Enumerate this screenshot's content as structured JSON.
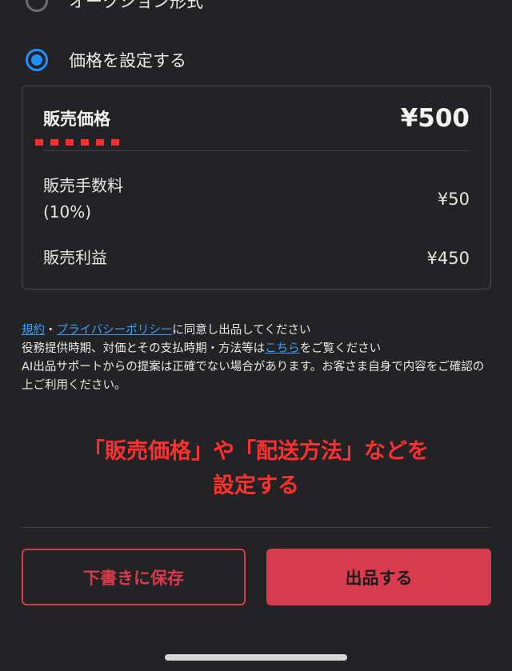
{
  "options": {
    "auction_label": "オークション形式",
    "fixed_price_label": "価格を設定する",
    "selected": "fixed_price"
  },
  "price_card": {
    "sale_price_label": "販売価格",
    "sale_price_value": "¥500",
    "fee_label_line1": "販売手数料",
    "fee_label_line2": "(10%)",
    "fee_value": "¥50",
    "profit_label": "販売利益",
    "profit_value": "¥450"
  },
  "notice": {
    "terms_link": "規約",
    "separator": "・",
    "privacy_link": "プライバシーポリシー",
    "agree_text": "に同意し出品してください",
    "line2_prefix": "役務提供時期、対価とその支払時期・方法等は",
    "here_link": "こちら",
    "line2_suffix": "をご覧ください",
    "line3": "AI出品サポートからの提案は正確でない場合があります。お客さま自身で内容をご確認の上ご利用ください。"
  },
  "annotation": {
    "line1": "「販売価格」や「配送方法」などを",
    "line2": "設定する"
  },
  "buttons": {
    "draft": "下書きに保存",
    "list": "出品する"
  },
  "colors": {
    "background": "#232325",
    "accent_red": "#d93b4e",
    "radio_blue": "#1e90ff",
    "link_blue": "#3aa0ff",
    "annotation_red": "#ff3030"
  }
}
